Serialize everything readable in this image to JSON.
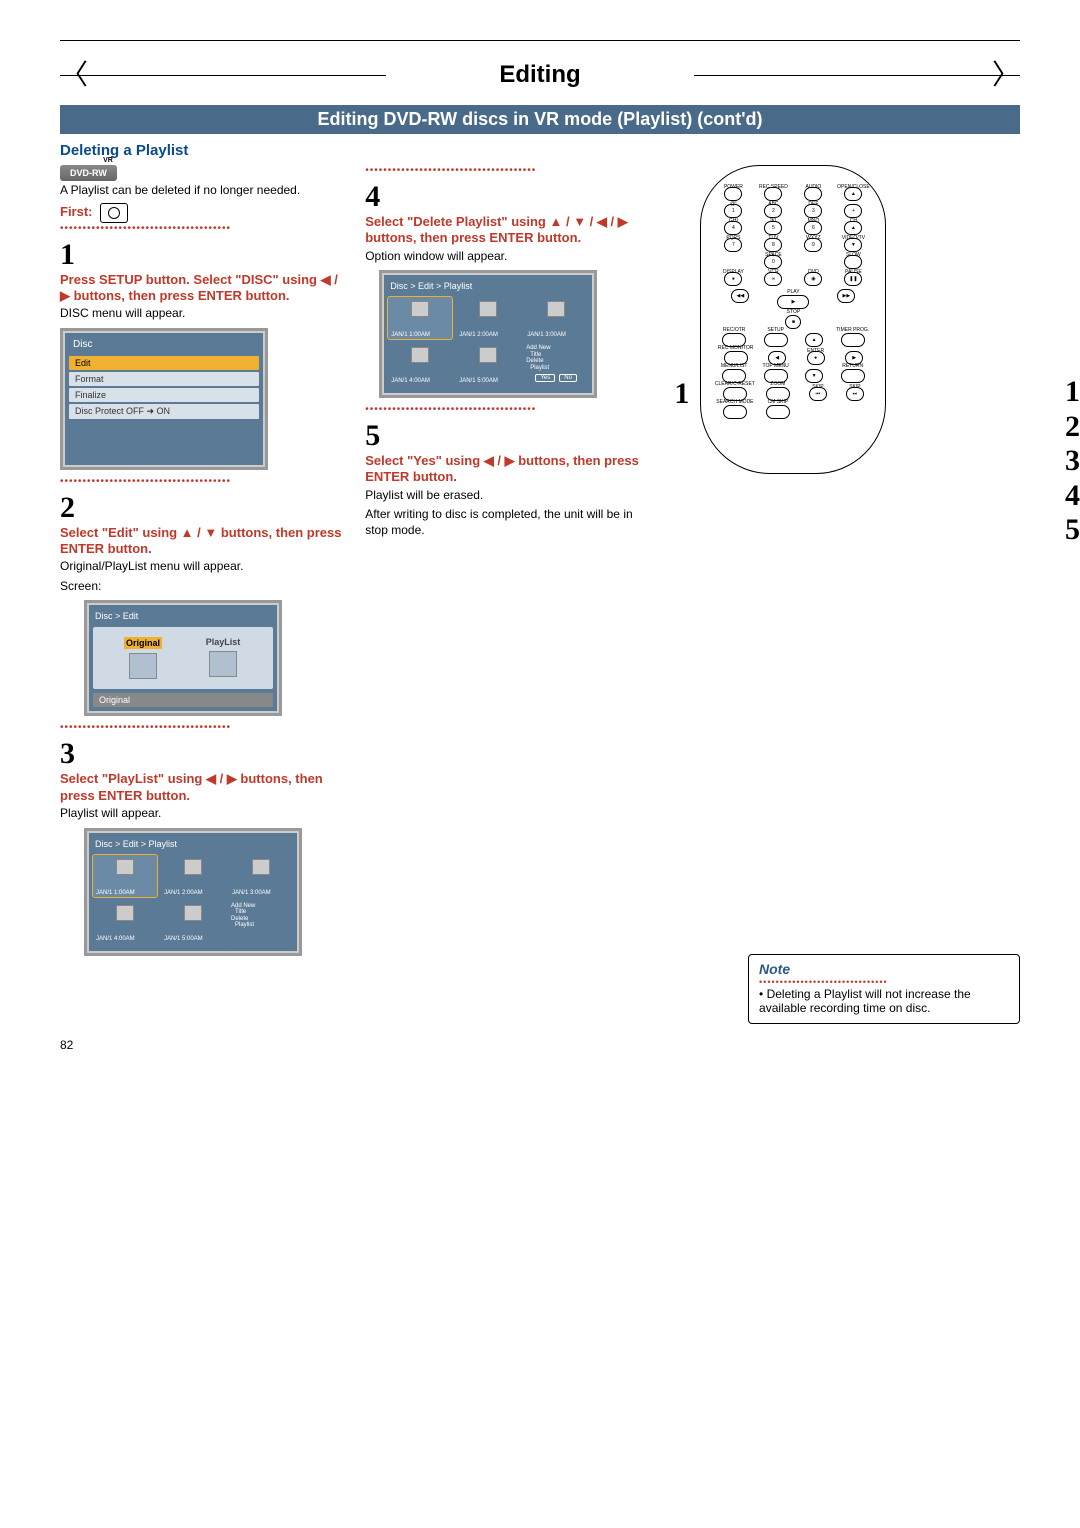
{
  "page_title": "Editing",
  "subtitle": "Editing DVD-RW discs in VR mode (Playlist) (cont'd)",
  "section_heading": "Deleting a Playlist",
  "badge": {
    "text": "DVD-RW",
    "vr": "VR"
  },
  "intro_text": "A Playlist can be deleted if no longer needed.",
  "first_label": "First:",
  "steps": {
    "s1": {
      "num": "1",
      "bold": "Press SETUP button. Select \"DISC\" using ◀ / ▶ buttons, then press ENTER button.",
      "body": "DISC menu will appear."
    },
    "s2": {
      "num": "2",
      "bold": "Select \"Edit\" using ▲ / ▼ buttons, then press ENTER button.",
      "body": "Original/PlayList menu will appear.",
      "screen_label": "Screen:"
    },
    "s3": {
      "num": "3",
      "bold": "Select \"PlayList\" using ◀ / ▶ buttons, then press ENTER button.",
      "body": "Playlist will appear."
    },
    "s4": {
      "num": "4",
      "bold": "Select \"Delete Playlist\" using ▲ / ▼ / ◀ / ▶ buttons, then press ENTER button.",
      "body": "Option window will appear."
    },
    "s5": {
      "num": "5",
      "bold": "Select \"Yes\" using ◀ / ▶ buttons, then press ENTER button.",
      "body1": "Playlist will be erased.",
      "body2": "After writing to disc is completed, the unit will be in stop mode."
    }
  },
  "disc_menu": {
    "header": "Disc",
    "items": [
      "Edit",
      "Format",
      "Finalize",
      "Disc Protect OFF ➜ ON"
    ]
  },
  "edit_screen": {
    "crumb": "Disc > Edit",
    "cell_a": "Original",
    "cell_b": "PlayList",
    "footer": "Original"
  },
  "playlist_screen": {
    "crumb": "Disc > Edit > Playlist",
    "labels": [
      "JAN/1  1:00AM",
      "JAN/1  2:00AM",
      "JAN/1  3:00AM",
      "JAN/1  4:00AM",
      "JAN/1  5:00AM"
    ],
    "options": {
      "l1": "Add New",
      "l2": "Title",
      "l3": "Delete",
      "l4": "Playlist",
      "yes": "Yes",
      "no": "No"
    }
  },
  "remote": {
    "row1": [
      "POWER",
      "REC SPEED",
      "AUDIO",
      "OPEN/CLOSE"
    ],
    "row2_lbl": [
      "@!",
      "ABC",
      "DEF",
      ""
    ],
    "row2": [
      "1",
      "2",
      "3",
      "+"
    ],
    "row3_lbl": [
      "GHI",
      "JKL",
      "MNO",
      "CH"
    ],
    "row3": [
      "4",
      "5",
      "6",
      "▲"
    ],
    "row4_lbl": [
      "PQRS",
      "TUV",
      "WXYZ",
      "VIDEO/TV"
    ],
    "row4": [
      "7",
      "8",
      "9",
      "▼"
    ],
    "row5_lbl": [
      "",
      "SPACE",
      "",
      "SLOW"
    ],
    "row5": [
      "",
      "0",
      "",
      ""
    ],
    "row6_lbl": [
      "DISPLAY",
      "VCR",
      "DVD",
      "PAUSE"
    ],
    "row6": [
      "●",
      "∞",
      "◉",
      "❚❚"
    ],
    "play_lbl": "PLAY",
    "rew": "◀◀",
    "ffwd": "▶▶",
    "stop_lbl": "STOP",
    "r7_lbl": [
      "REC/OTR",
      "SETUP",
      "",
      "TIMER PROG."
    ],
    "r8_lbl": [
      "REC MONITOR",
      "",
      "ENTER",
      ""
    ],
    "r9_lbl": [
      "MENU/LIST",
      "TOP MENU",
      "",
      "RETURN"
    ],
    "r10_lbl": [
      "CLEAR/C-RESET",
      "ZOOM",
      "SKIP",
      "SKIP"
    ],
    "r11_lbl": [
      "SEARCH MODE",
      "CM SKIP",
      "",
      ""
    ]
  },
  "callout_left": "1",
  "callouts_right": [
    "1",
    "2",
    "3",
    "4",
    "5"
  ],
  "note": {
    "title": "Note",
    "text": "Deleting a Playlist will not increase the available recording time on disc."
  },
  "page_num": "82"
}
